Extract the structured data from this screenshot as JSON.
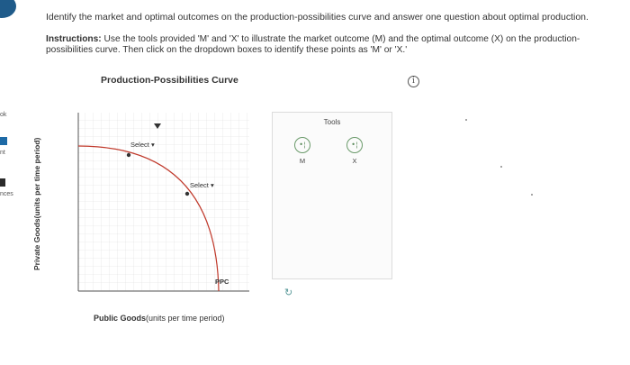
{
  "sidebar": {
    "items": [
      {
        "label": "ok",
        "icon": "book-icon"
      },
      {
        "label": "nt",
        "icon": "flag-icon"
      },
      {
        "label": "nces",
        "icon": "document-icon"
      }
    ]
  },
  "question": {
    "prompt": "Identify the market and optimal outcomes on the production-possibilities curve and answer one question about optimal production.",
    "instructions_label": "Instructions:",
    "instructions_text": " Use the tools provided 'M' and 'X' to illustrate the market outcome (M) and the optimal outcome (X) on the production-possibilities curve. Then click on the dropdown boxes to identify these points as 'M' or 'X.'"
  },
  "chart": {
    "title": "Production-Possibilities Curve",
    "info_icon": "info-icon",
    "ylabel": "Private Goods(units per time period)",
    "xlabel_bold": "Public Goods",
    "xlabel_rest": "(units per time period)",
    "curve_label": "PPC",
    "dropdowns": [
      {
        "value": "Select",
        "name": "upper"
      },
      {
        "value": "Select",
        "name": "lower"
      }
    ],
    "curve_color": "#c0392b",
    "point_color": "#333333"
  },
  "chart_data": {
    "type": "line",
    "title": "Production-Possibilities Curve",
    "xlabel": "Public Goods(units per time period)",
    "ylabel": "Private Goods(units per time period)",
    "series": [
      {
        "name": "PPC",
        "shape": "concave curve from y-axis to x-axis"
      }
    ],
    "points": [
      {
        "label": "Select",
        "on": "PPC",
        "position": "upper"
      },
      {
        "label": "Select",
        "on": "PPC",
        "position": "lower"
      }
    ],
    "grid": true
  },
  "tools": {
    "title": "Tools",
    "items": [
      {
        "label": "M",
        "icon": "point-tool-icon"
      },
      {
        "label": "X",
        "icon": "point-tool-icon"
      }
    ],
    "reset_icon": "reset-icon"
  }
}
